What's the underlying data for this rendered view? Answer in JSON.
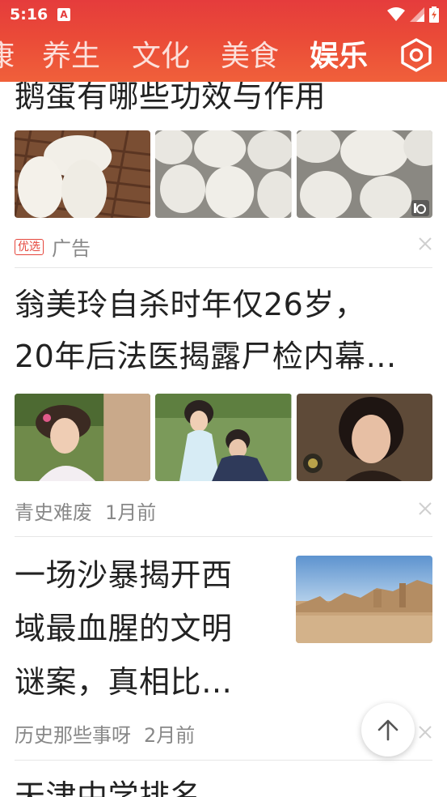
{
  "status_bar": {
    "time": "5:16",
    "notification_badge": "A",
    "icons": [
      "wifi-icon",
      "signal-icon",
      "battery-icon"
    ]
  },
  "tabs": [
    {
      "label": "康",
      "active": false
    },
    {
      "label": "养生",
      "active": false
    },
    {
      "label": "文化",
      "active": false
    },
    {
      "label": "美食",
      "active": false
    },
    {
      "label": "娱乐",
      "active": true
    }
  ],
  "feed": [
    {
      "title": "鹅蛋有哪些功效与作用",
      "badge": "优选",
      "source": "广告",
      "time": ""
    },
    {
      "title_line1": "翁美玲自杀时年仅26岁，",
      "title_line2": "20年后法医揭露尸检内幕…",
      "source": "青史难废",
      "time": "1月前"
    },
    {
      "title_line1": "一场沙暴揭开西",
      "title_line2": "域最血腥的文明",
      "title_line3": "谜案，真相比…",
      "source": "历史那些事呀",
      "time": "2月前"
    },
    {
      "title": "天津中学排名"
    }
  ],
  "colors": {
    "header_red": "#e53c3c",
    "accent_red": "#e5463c",
    "text_main": "#222222",
    "text_meta": "#888888"
  }
}
